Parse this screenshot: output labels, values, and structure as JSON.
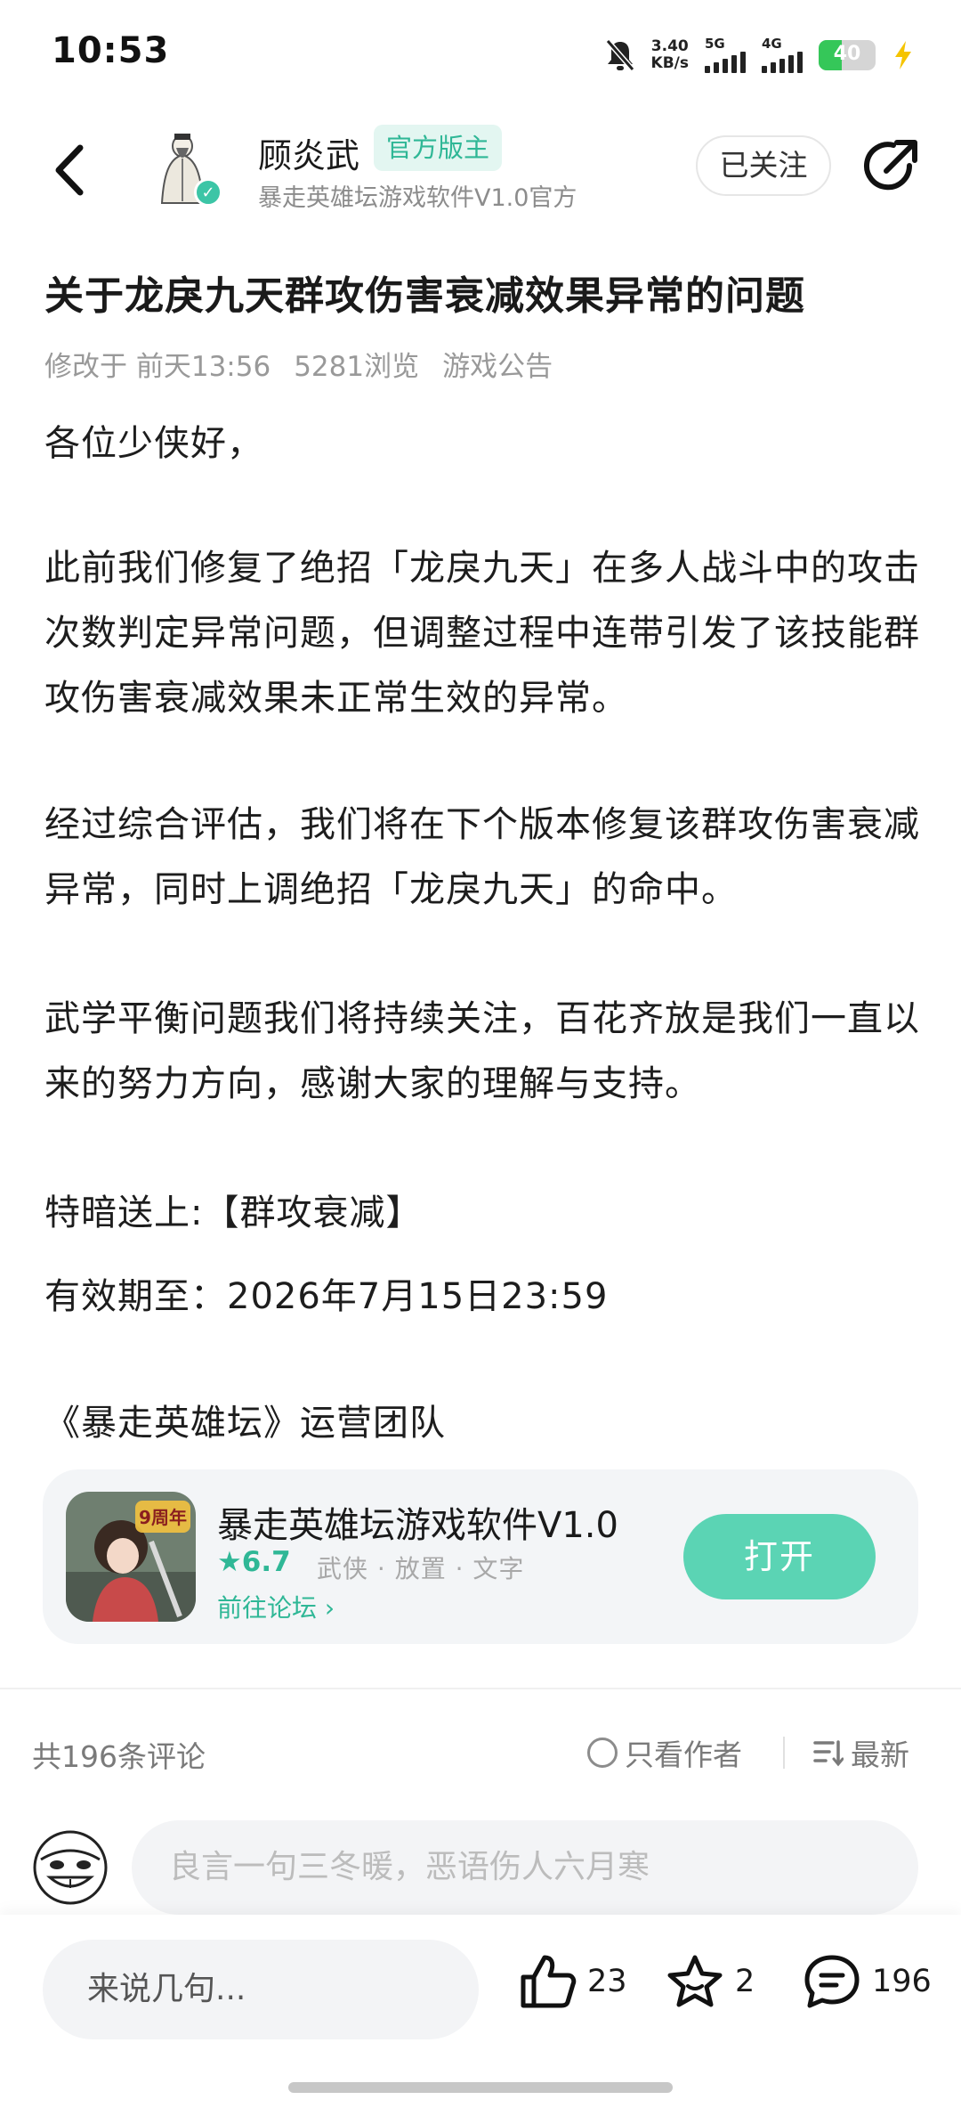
{
  "status_bar": {
    "time": "10:53",
    "net_speed_value": "3.40",
    "net_speed_unit": "KB/s",
    "signal1_label": "5G",
    "signal2_label": "4G",
    "battery": "40",
    "battery_level": 0.4
  },
  "header": {
    "author_name": "顾炎武",
    "official_tag": "官方版主",
    "author_subtitle": "暴走英雄坛游戏软件V1.0官方",
    "follow_label": "已关注"
  },
  "post": {
    "title": "关于龙戾九天群攻伤害衰减效果异常的问题",
    "modified_label": "修改于",
    "modified_time": "前天13:56",
    "views": "5281浏览",
    "category": "游戏公告",
    "paragraphs": [
      "各位少侠好，",
      "此前我们修复了绝招「龙戾九天」在多人战斗中的攻击次数判定异常问题，但调整过程中连带引发了该技能群攻伤害衰减效果未正常生效的异常。",
      "经过综合评估，我们将在下个版本修复该群攻伤害衰减异常，同时上调绝招「龙戾九天」的命中。",
      "武学平衡问题我们将持续关注，百花齐放是我们一直以来的努力方向，感谢大家的理解与支持。",
      "特暗送上:【群攻衰减】",
      "有效期至：2026年7月15日23:59",
      "《暴走英雄坛》运营团队"
    ]
  },
  "app_card": {
    "icon_text": "9周年",
    "name": "暴走英雄坛游戏软件V1.0",
    "rating": "6.7",
    "tags": "武侠 · 放置 · 文字",
    "forum_link": "前往论坛",
    "open_label": "打开"
  },
  "comments": {
    "count_label": "共196条评论",
    "only_author": "只看作者",
    "sort_label": "最新",
    "input_placeholder": "良言一句三冬暖，恶语伤人六月寒"
  },
  "bottom_bar": {
    "say_placeholder": "来说几句...",
    "likes": "23",
    "favorites": "2",
    "comments": "196"
  },
  "colors": {
    "accent": "#2fb796",
    "open_button": "#5bd4b4",
    "tag_bg": "#e3f6f1",
    "battery_green": "#35c759"
  },
  "icons": {
    "back": "back-arrow-icon",
    "share": "share-icon",
    "verified": "verified-check-icon",
    "star": "star-icon",
    "chevron": "chevron-right-icon",
    "sort": "sort-lines-icon",
    "like": "thumbs-up-icon",
    "favorite": "star-outline-icon",
    "comment": "chat-bubble-icon"
  }
}
